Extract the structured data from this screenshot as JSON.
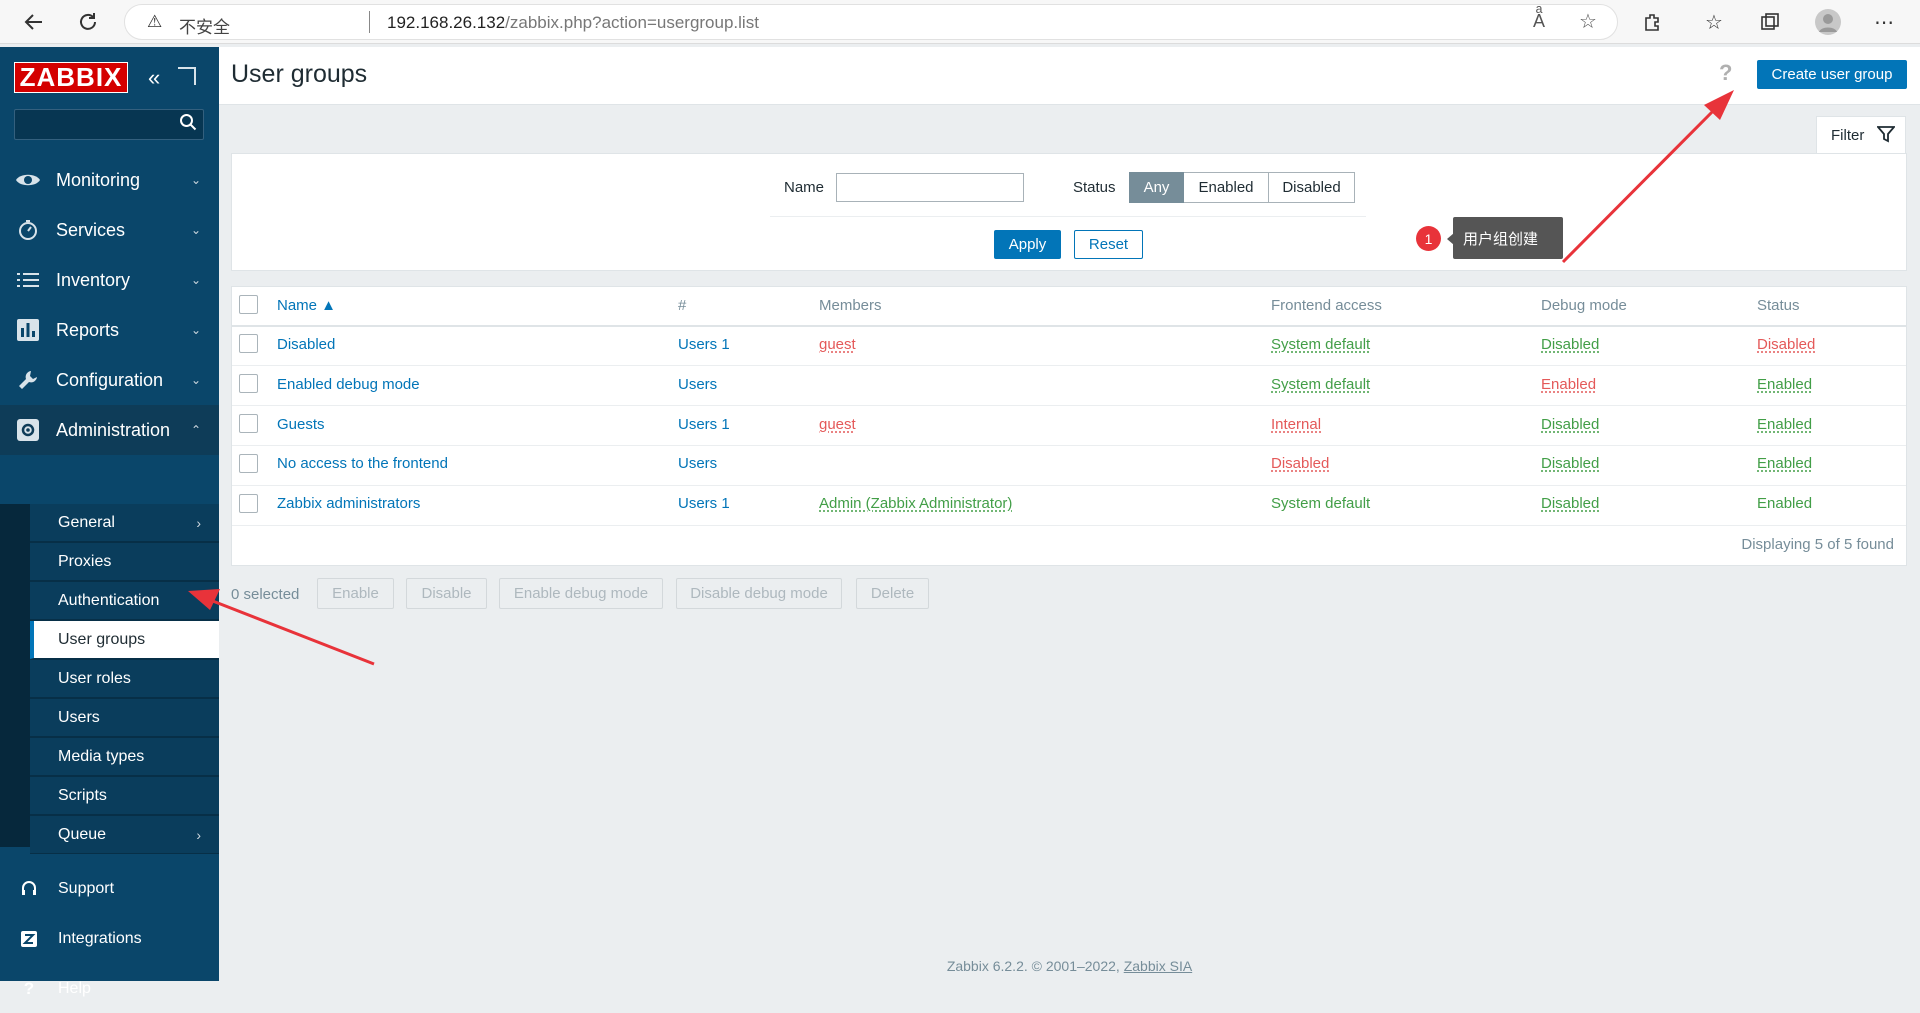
{
  "browser": {
    "warning_label": "不安全",
    "url_host": "192.168.26.132",
    "url_path": "/zabbix.php?action=usergroup.list"
  },
  "sidebar": {
    "logo": "ZABBIX",
    "search_placeholder": "",
    "items": [
      {
        "label": "Monitoring",
        "icon": "eye-icon"
      },
      {
        "label": "Services",
        "icon": "stopwatch-icon"
      },
      {
        "label": "Inventory",
        "icon": "list-icon"
      },
      {
        "label": "Reports",
        "icon": "bar-chart-icon"
      },
      {
        "label": "Configuration",
        "icon": "wrench-icon"
      },
      {
        "label": "Administration",
        "icon": "gear-icon"
      }
    ],
    "admin_submenu": [
      "General",
      "Proxies",
      "Authentication",
      "User groups",
      "User roles",
      "Users",
      "Media types",
      "Scripts",
      "Queue"
    ],
    "footer": [
      {
        "label": "Support",
        "icon": "headset-icon"
      },
      {
        "label": "Integrations",
        "icon": "z-icon"
      },
      {
        "label": "Help",
        "icon": "question-icon"
      }
    ]
  },
  "header": {
    "title": "User groups",
    "help": "?",
    "create_label": "Create user group"
  },
  "filter": {
    "tab_label": "Filter",
    "name_label": "Name",
    "name_value": "",
    "status_label": "Status",
    "status_options": [
      "Any",
      "Enabled",
      "Disabled"
    ],
    "status_selected": "Any",
    "apply_label": "Apply",
    "reset_label": "Reset"
  },
  "annotation": {
    "step": "1",
    "text": "用户组创建"
  },
  "table": {
    "columns": [
      "Name ▲",
      "#",
      "Members",
      "Frontend access",
      "Debug mode",
      "Status"
    ],
    "rows": [
      {
        "name": "Disabled",
        "count": "Users 1",
        "members": "guest",
        "frontend": "System default",
        "debug": "Disabled",
        "status": "Disabled"
      },
      {
        "name": "Enabled debug mode",
        "count": "Users",
        "members": "",
        "frontend": "System default",
        "debug": "Enabled",
        "status": "Enabled"
      },
      {
        "name": "Guests",
        "count": "Users 1",
        "members": "guest",
        "frontend": "Internal",
        "debug": "Disabled",
        "status": "Enabled"
      },
      {
        "name": "No access to the frontend",
        "count": "Users",
        "members": "",
        "frontend": "Disabled",
        "debug": "Disabled",
        "status": "Enabled"
      },
      {
        "name": "Zabbix administrators",
        "count": "Users 1",
        "members": "Admin (Zabbix Administrator)",
        "frontend": "System default",
        "debug": "Disabled",
        "status": "Enabled"
      }
    ],
    "displaying": "Displaying 5 of 5 found"
  },
  "mass_actions": {
    "selected": "0 selected",
    "buttons": [
      "Enable",
      "Disable",
      "Enable debug mode",
      "Disable debug mode",
      "Delete"
    ]
  },
  "footer": {
    "text": "Zabbix 6.2.2. © 2001–2022,",
    "link": "Zabbix SIA"
  },
  "colors": {
    "sidebar": "#0a466a",
    "accent": "#0275b8",
    "green": "#429e47",
    "red": "#e45959",
    "annotation_red": "#e8333a"
  }
}
